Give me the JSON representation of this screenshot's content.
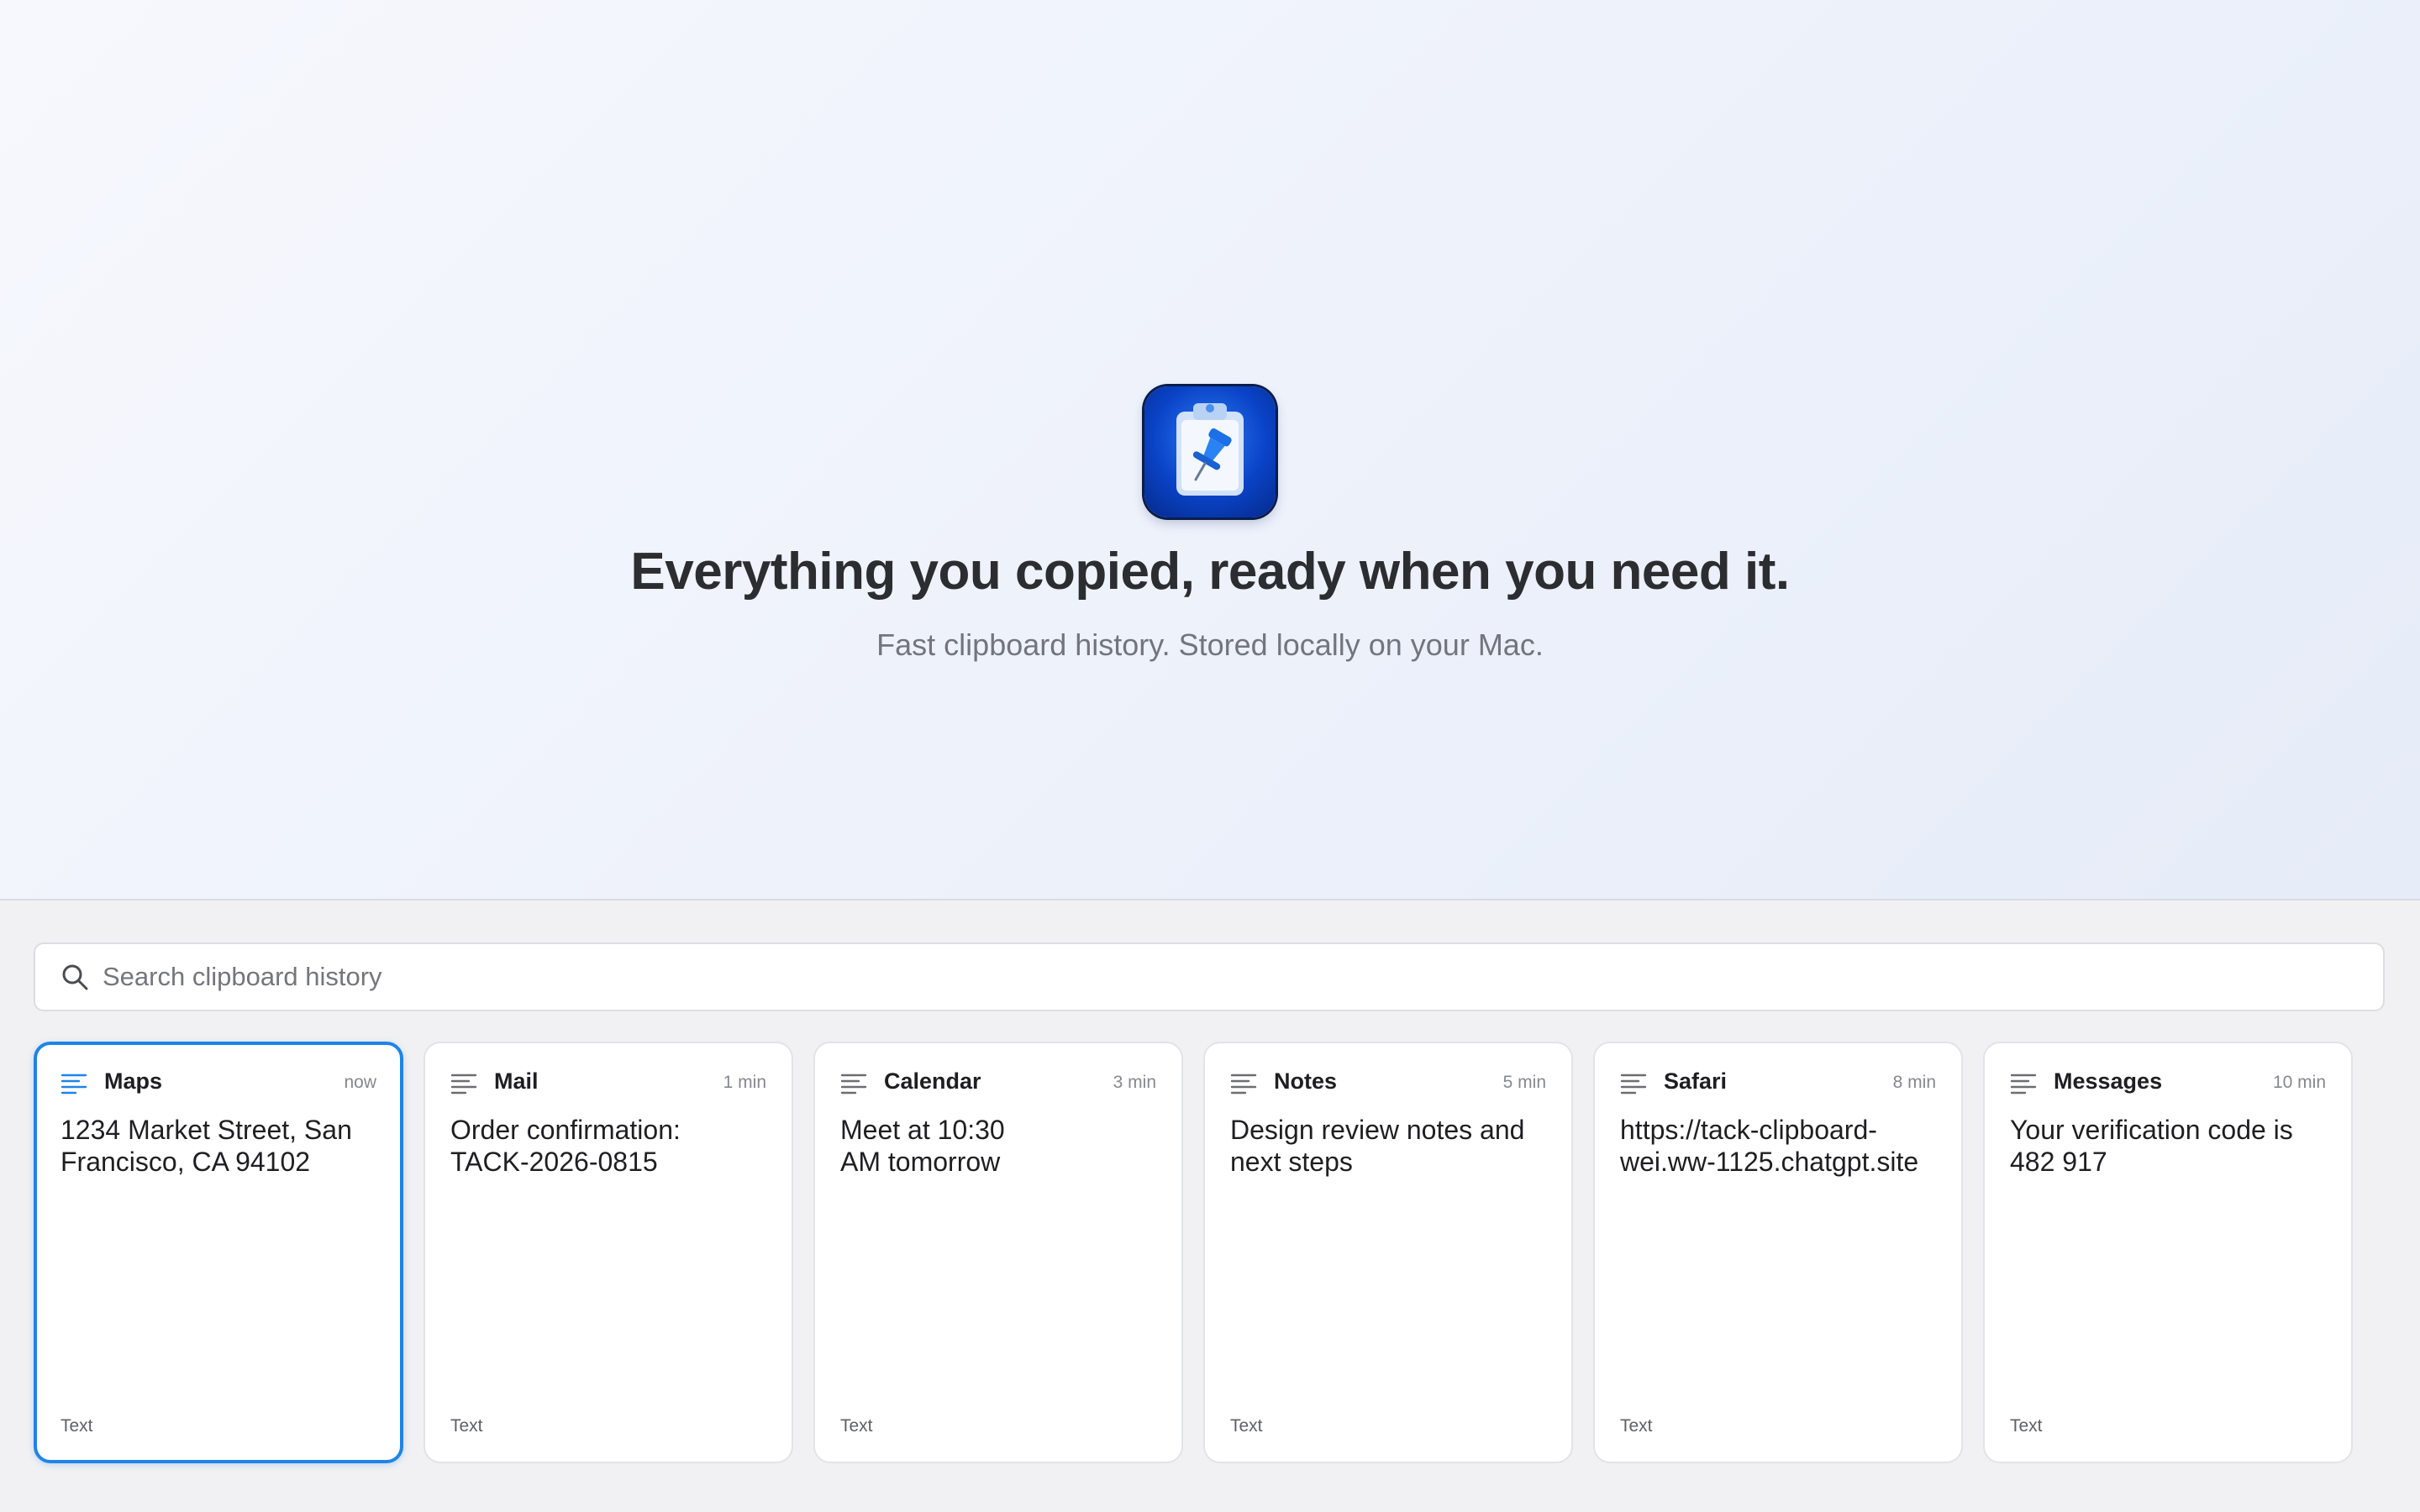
{
  "hero": {
    "app_icon": "clipboard-pushpin-icon",
    "title": "Everything you copied, ready when you need it.",
    "subtitle": "Fast clipboard history. Stored locally on your Mac."
  },
  "search": {
    "icon": "search-icon",
    "placeholder": "Search clipboard history",
    "value": ""
  },
  "accent_color": "#1f84e6",
  "cards": [
    {
      "app": "Maps",
      "time": "now",
      "content": "1234 Market Street, San\nFrancisco, CA 94102",
      "type": "Text",
      "icon": "text-lines-icon",
      "selected": true
    },
    {
      "app": "Mail",
      "time": "1 min",
      "content": "Order confirmation:\nTACK-2026-0815",
      "type": "Text",
      "icon": "text-lines-icon",
      "selected": false
    },
    {
      "app": "Calendar",
      "time": "3 min",
      "content": "Meet at 10:30\nAM tomorrow",
      "type": "Text",
      "icon": "text-lines-icon",
      "selected": false
    },
    {
      "app": "Notes",
      "time": "5 min",
      "content": "Design review notes and\nnext steps",
      "type": "Text",
      "icon": "text-lines-icon",
      "selected": false
    },
    {
      "app": "Safari",
      "time": "8 min",
      "content": "https://tack-clipboard-\nwei.ww-1125.chatgpt.site",
      "type": "Text",
      "icon": "text-lines-icon",
      "selected": false
    },
    {
      "app": "Messages",
      "time": "10 min",
      "content": "Your verification code is\n482 917",
      "type": "Text",
      "icon": "text-lines-icon",
      "selected": false
    }
  ]
}
